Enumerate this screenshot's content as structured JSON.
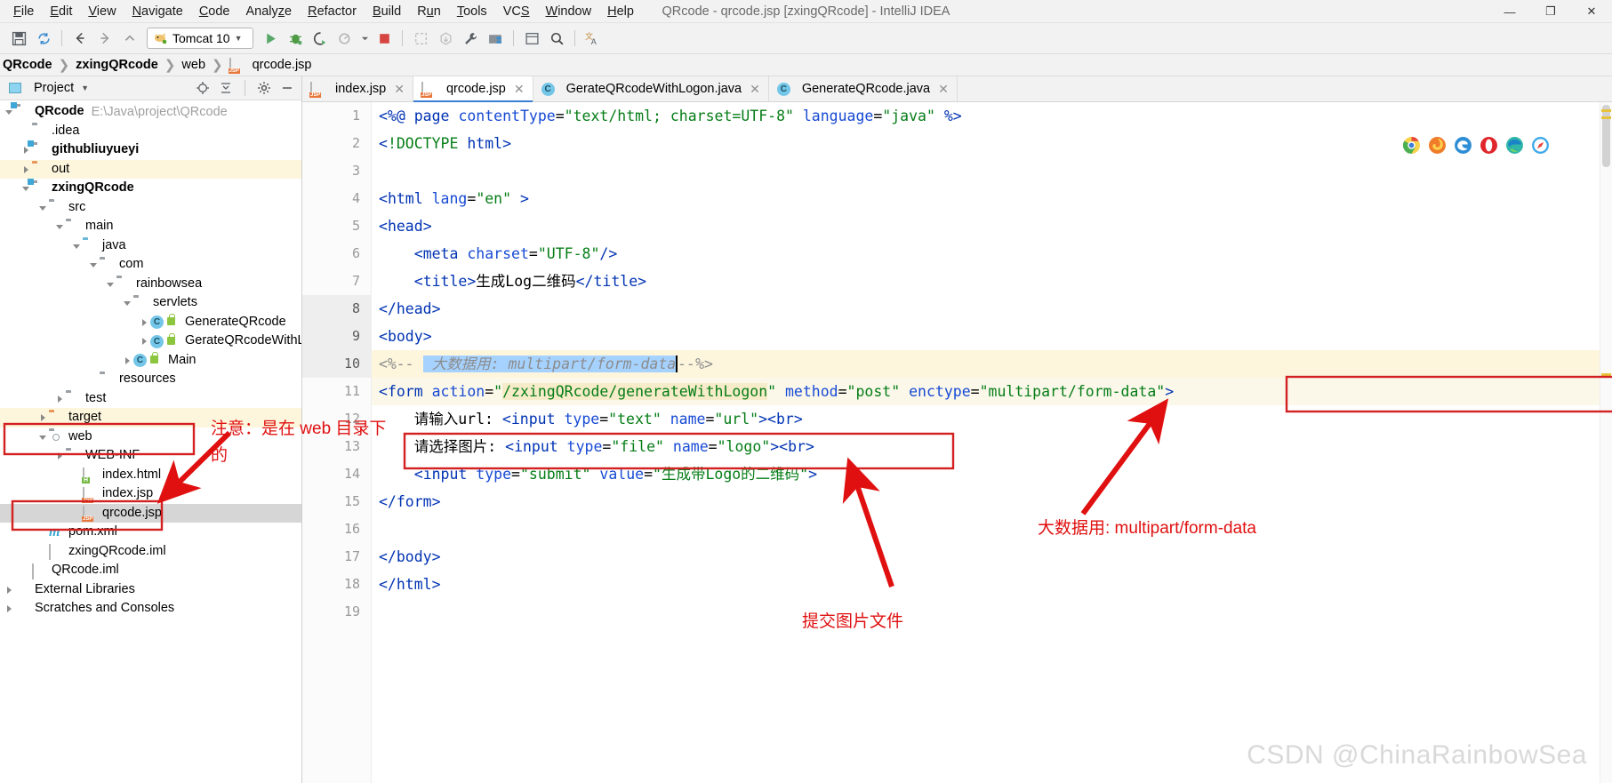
{
  "window": {
    "title": "QRcode - qrcode.jsp [zxingQRcode] - IntelliJ IDEA",
    "minimize": "—",
    "maximize": "❐",
    "close": "✕"
  },
  "menubar": [
    {
      "label": "File"
    },
    {
      "label": "Edit"
    },
    {
      "label": "View"
    },
    {
      "label": "Navigate"
    },
    {
      "label": "Code"
    },
    {
      "label": "Analyze"
    },
    {
      "label": "Refactor"
    },
    {
      "label": "Build"
    },
    {
      "label": "Run"
    },
    {
      "label": "Tools"
    },
    {
      "label": "VCS"
    },
    {
      "label": "Window"
    },
    {
      "label": "Help"
    }
  ],
  "toolbar": {
    "run_config": "Tomcat 10",
    "run_config_caret": "▼",
    "icons": [
      {
        "name": "save-icon"
      },
      {
        "name": "sync-icon"
      },
      {
        "name": "back-arrow-icon"
      },
      {
        "name": "forward-arrow-icon"
      },
      {
        "name": "up-arrow-icon"
      },
      {
        "name": "run-icon"
      },
      {
        "name": "debug-icon"
      },
      {
        "name": "run-coverage-icon"
      },
      {
        "name": "profile-icon"
      },
      {
        "name": "stop-icon"
      },
      {
        "name": "deploy-icon"
      },
      {
        "name": "update-app-icon"
      },
      {
        "name": "build-wrench-icon"
      },
      {
        "name": "project-structure-icon"
      },
      {
        "name": "ui-designer-icon"
      },
      {
        "name": "search-icon"
      },
      {
        "name": "translate-icon"
      }
    ]
  },
  "breadcrumb": {
    "items": [
      "QRcode",
      "zxingQRcode",
      "web",
      "qrcode.jsp"
    ]
  },
  "project_panel": {
    "title": "Project",
    "title_caret": "▼",
    "header_icons": [
      "locate-icon",
      "collapse-all-icon",
      "settings-gear-icon",
      "hide-icon"
    ],
    "tree": [
      {
        "label": "QRcode",
        "path": "E:\\Java\\project\\QRcode",
        "icon": "module-icon",
        "indent": 0,
        "arrow": "down",
        "bold": true
      },
      {
        "label": ".idea",
        "icon": "folder-icon",
        "indent": 1,
        "arrow": "none",
        "bold": false
      },
      {
        "label": "githubliuyueyi",
        "icon": "module-icon",
        "indent": 1,
        "arrow": "right",
        "bold": true
      },
      {
        "label": "out",
        "icon": "folder-orange-icon",
        "indent": 1,
        "arrow": "right",
        "bold": false,
        "highlight": true
      },
      {
        "label": "zxingQRcode",
        "icon": "module-icon",
        "indent": 1,
        "arrow": "down",
        "bold": true
      },
      {
        "label": "src",
        "icon": "folder-icon",
        "indent": 2,
        "arrow": "down",
        "bold": false
      },
      {
        "label": "main",
        "icon": "folder-icon",
        "indent": 3,
        "arrow": "down",
        "bold": false
      },
      {
        "label": "java",
        "icon": "folder-source-icon",
        "indent": 4,
        "arrow": "down",
        "bold": false
      },
      {
        "label": "com",
        "icon": "package-icon",
        "indent": 5,
        "arrow": "down",
        "bold": false
      },
      {
        "label": "rainbowsea",
        "icon": "package-icon",
        "indent": 6,
        "arrow": "down",
        "bold": false
      },
      {
        "label": "servlets",
        "icon": "package-icon",
        "indent": 7,
        "arrow": "down",
        "bold": false
      },
      {
        "label": "GenerateQRcode",
        "icon": "java-class-icon",
        "indent": 8,
        "arrow": "right",
        "bold": false
      },
      {
        "label": "GerateQRcodeWithLogon",
        "icon": "java-class-icon",
        "indent": 8,
        "arrow": "right",
        "bold": false
      },
      {
        "label": "Main",
        "icon": "java-class-runnable-icon",
        "indent": 7,
        "arrow": "right",
        "bold": false
      },
      {
        "label": "resources",
        "icon": "resources-folder-icon",
        "indent": 5,
        "arrow": "none",
        "bold": false
      },
      {
        "label": "test",
        "icon": "folder-icon",
        "indent": 3,
        "arrow": "right",
        "bold": false
      },
      {
        "label": "target",
        "icon": "folder-orange-icon",
        "indent": 2,
        "arrow": "right",
        "bold": false,
        "highlight": true
      },
      {
        "label": "web",
        "icon": "web-folder-icon",
        "indent": 2,
        "arrow": "down",
        "bold": false
      },
      {
        "label": "WEB-INF",
        "icon": "folder-icon",
        "indent": 3,
        "arrow": "right",
        "bold": false
      },
      {
        "label": "index.html",
        "icon": "html-file-icon",
        "indent": 4,
        "arrow": "none",
        "bold": false
      },
      {
        "label": "index.jsp",
        "icon": "jsp-file-icon",
        "indent": 4,
        "arrow": "none",
        "bold": false
      },
      {
        "label": "qrcode.jsp",
        "icon": "jsp-file-icon",
        "indent": 4,
        "arrow": "none",
        "bold": false,
        "selected": true
      },
      {
        "label": "pom.xml",
        "icon": "maven-file-icon",
        "indent": 2,
        "arrow": "none",
        "bold": false
      },
      {
        "label": "zxingQRcode.iml",
        "icon": "iml-file-icon",
        "indent": 2,
        "arrow": "none",
        "bold": false
      },
      {
        "label": "QRcode.iml",
        "icon": "iml-file-icon",
        "indent": 1,
        "arrow": "none",
        "bold": false
      },
      {
        "label": "External Libraries",
        "icon": "library-icon",
        "indent": 0,
        "arrow": "right",
        "bold": false
      },
      {
        "label": "Scratches and Consoles",
        "icon": "scratches-icon",
        "indent": 0,
        "arrow": "right",
        "bold": false
      }
    ]
  },
  "editor_tabs": [
    {
      "label": "index.jsp",
      "icon": "jsp-file-icon",
      "active": false,
      "close": "✕"
    },
    {
      "label": "qrcode.jsp",
      "icon": "jsp-file-icon",
      "active": true,
      "close": "✕"
    },
    {
      "label": "GerateQRcodeWithLogon.java",
      "icon": "java-class-icon",
      "active": false,
      "close": "✕"
    },
    {
      "label": "GenerateQRcode.java",
      "icon": "java-class-icon",
      "active": false,
      "close": "✕"
    }
  ],
  "code": {
    "line_numbers": [
      "1",
      "2",
      "3",
      "4",
      "5",
      "6",
      "7",
      "8",
      "9",
      "10",
      "11",
      "12",
      "13",
      "14",
      "15",
      "16",
      "17",
      "18",
      "19"
    ],
    "lines": [
      "<%@ page contentType=\"text/html; charset=UTF-8\" language=\"java\" %>",
      "<!DOCTYPE html>",
      "",
      "<html lang=\"en\" >",
      "<head>",
      "    <meta charset=\"UTF-8\"/>",
      "    <title>生成Log二维码</title>",
      "</head>",
      "<body>",
      "<%--  大数据用: multipart/form-data--%>",
      "<form action=\"/zxingQRcode/generateWithLogon\" method=\"post\" enctype=\"multipart/form-data\">",
      "    请输入url: <input type=\"text\" name=\"url\"><br>",
      "    请选择图片: <input type=\"file\" name=\"logo\"><br>",
      "    <input type=\"submit\" value=\"生成带Logo的二维码\">",
      "</form>",
      "",
      "</body>",
      "</html>",
      ""
    ]
  },
  "browser_icons": [
    "chrome-icon",
    "firefox-icon",
    "edge-legacy-icon",
    "opera-icon",
    "edge-icon",
    "safari-icon"
  ],
  "annotations": [
    {
      "name": "note-web-directory",
      "text": "注意：是在 web 目录下\n的",
      "color": "#e01010"
    },
    {
      "name": "note-submit-image-file",
      "text": "提交图片文件",
      "color": "#e01010"
    },
    {
      "name": "note-big-data-multipart",
      "text": "大数据用: multipart/form-data",
      "color": "#e01010"
    }
  ],
  "watermark": "CSDN @ChinaRainbowSea",
  "colors": {
    "accent": "#3b7fd4",
    "annotation_red": "#d32020",
    "string_green": "#067d17",
    "keyword_blue": "#0033b3",
    "highlight_yellow": "#fdf6dd",
    "selection_blue": "#a6d2ff"
  }
}
